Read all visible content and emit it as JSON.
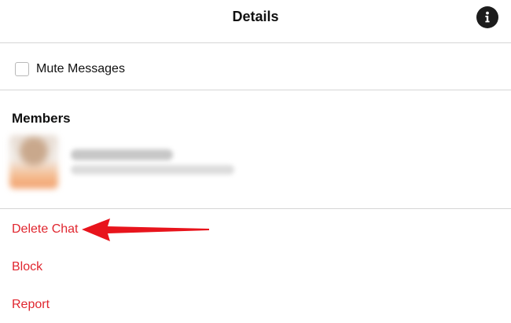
{
  "header": {
    "title": "Details",
    "info_icon": "info-icon"
  },
  "mute": {
    "label": "Mute Messages",
    "checked": false
  },
  "members": {
    "heading": "Members",
    "items": [
      {
        "avatar": "avatar",
        "blurred": true
      }
    ]
  },
  "actions": {
    "delete_label": "Delete Chat",
    "block_label": "Block",
    "report_label": "Report"
  },
  "annotation": {
    "icon": "arrow-left-icon",
    "color": "#e8141c"
  },
  "colors": {
    "destructive": "#e0262f",
    "divider": "#d6d6d6"
  }
}
